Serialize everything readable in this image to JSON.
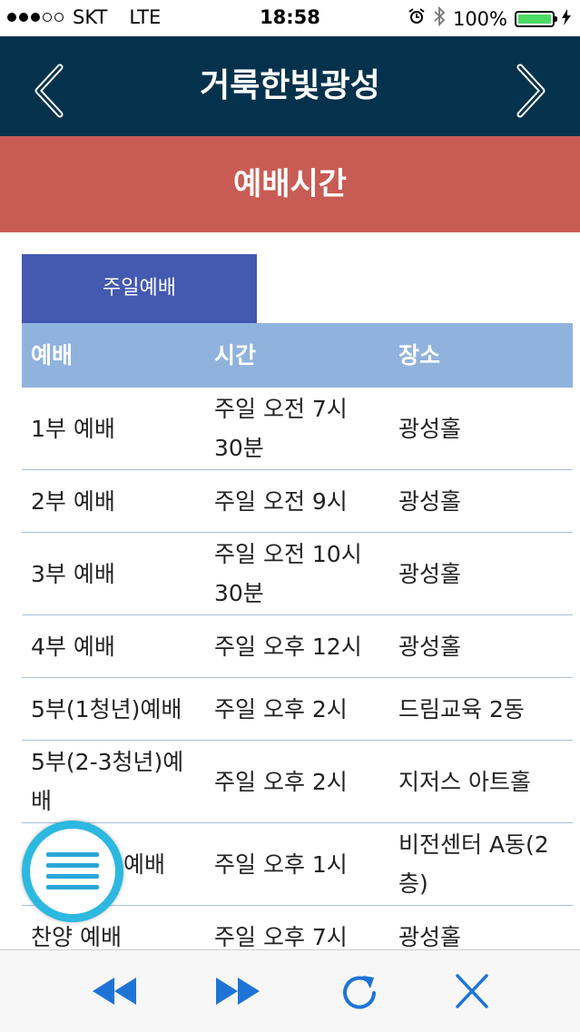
{
  "status_bar": {
    "carrier": "SKT",
    "network": "LTE",
    "time": "18:58",
    "battery": "100%",
    "signal_strength": 3
  },
  "header": {
    "title": "거룩한빛광성",
    "back_icon": "chevron-left-icon",
    "forward_icon": "chevron-right-icon"
  },
  "section": {
    "title": "예배시간"
  },
  "tab": {
    "label": "주일예배"
  },
  "table": {
    "columns": [
      "예배",
      "시간",
      "장소"
    ],
    "rows": [
      {
        "service": "1부 예배",
        "time_lines": [
          "주일 오전 7시",
          "30분"
        ],
        "place_lines": [
          "광성홀"
        ]
      },
      {
        "service": "2부 예배",
        "time_lines": [
          "주일 오전 9시"
        ],
        "place_lines": [
          "광성홀"
        ]
      },
      {
        "service": "3부 예배",
        "time_lines": [
          "주일 오전 10시",
          "30분"
        ],
        "place_lines": [
          "광성홀"
        ]
      },
      {
        "service": "4부 예배",
        "time_lines": [
          "주일 오후 12시"
        ],
        "place_lines": [
          "광성홀"
        ]
      },
      {
        "service": "5부(1청년)예배",
        "time_lines": [
          "주일 오후 2시"
        ],
        "place_lines": [
          "드림교육 2동"
        ]
      },
      {
        "service_lines": [
          "5부(2-3청년)예",
          "배"
        ],
        "time_lines": [
          "주일 오후 2시"
        ],
        "place_lines": [
          "지저스 아트홀"
        ]
      },
      {
        "service": "예배",
        "time_lines": [
          "주일 오후 1시"
        ],
        "place_lines": [
          "비전센터 A동(2",
          "층)"
        ]
      },
      {
        "service": "찬양 예배",
        "time_lines": [
          "주일 오후 7시"
        ],
        "place_lines": [
          "광성홀"
        ]
      }
    ]
  },
  "toolbar": {
    "rewind_icon": "rewind-icon",
    "fast_forward_icon": "fast-forward-icon",
    "refresh_icon": "refresh-icon",
    "close_icon": "close-icon"
  },
  "colors": {
    "header_bg": "#04324c",
    "band_bg": "#c85c54",
    "tab_bg": "#4459b0",
    "table_header_bg": "#90b3dd",
    "accent_blue": "#1e74d6",
    "fab_ring": "#2cb8e0"
  }
}
